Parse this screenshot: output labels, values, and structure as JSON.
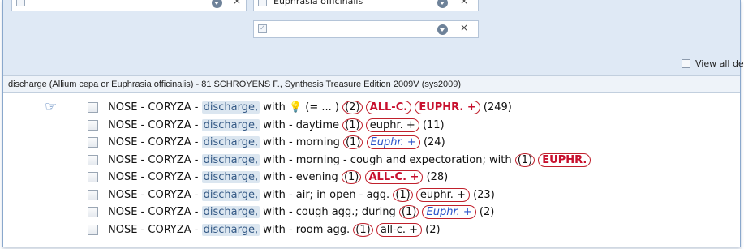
{
  "filters": {
    "combo1_text": "",
    "combo2_text": "Euphrasia officinalis",
    "combo3_text": "",
    "clear_glyph": "×",
    "view_all_label": "View all de"
  },
  "status_bar": {
    "text": "discharge (Allium cepa or Euphrasia officinalis) - 81   SCHROYENS F., Synthesis Treasure Edition 2009V (sys2009)"
  },
  "rubrics": [
    {
      "text": "NOSE - CORYZA - ",
      "keyword": "discharge,",
      "rest": " with ",
      "bulb": true,
      "extra": "  (= ... ) ",
      "count": "(2)",
      "remedies": [
        {
          "name": "ALL-C.",
          "style": "red"
        },
        {
          "name": "EUPHR. +",
          "style": "red"
        }
      ],
      "total": "(249)",
      "pointer": true
    },
    {
      "text": "NOSE - CORYZA - ",
      "keyword": "discharge,",
      "rest": " with - daytime ",
      "count": "(1)",
      "remedies": [
        {
          "name": "euphr. +",
          "style": "plain"
        }
      ],
      "total": "(11)"
    },
    {
      "text": "NOSE - CORYZA - ",
      "keyword": "discharge,",
      "rest": " with - morning ",
      "count": "(1)",
      "remedies": [
        {
          "name": "Euphr. +",
          "style": "blue"
        }
      ],
      "total": "(24)"
    },
    {
      "text": "NOSE - CORYZA - ",
      "keyword": "discharge,",
      "rest": " with - morning - cough and expectoration; with ",
      "count": "(1)",
      "remedies": [
        {
          "name": "EUPHR.",
          "style": "red"
        }
      ],
      "total": ""
    },
    {
      "text": "NOSE - CORYZA - ",
      "keyword": "discharge,",
      "rest": " with - evening ",
      "count": "(1)",
      "remedies": [
        {
          "name": "ALL-C. +",
          "style": "red"
        }
      ],
      "total": "(28)"
    },
    {
      "text": "NOSE - CORYZA - ",
      "keyword": "discharge,",
      "rest": " with - air; in open - agg. ",
      "count": "(1)",
      "remedies": [
        {
          "name": "euphr. +",
          "style": "plain"
        }
      ],
      "total": "(23)"
    },
    {
      "text": "NOSE - CORYZA - ",
      "keyword": "discharge,",
      "rest": " with - cough agg.; during ",
      "count": "(1)",
      "remedies": [
        {
          "name": "Euphr. +",
          "style": "blue"
        }
      ],
      "total": "(2)"
    },
    {
      "text": "NOSE - CORYZA - ",
      "keyword": "discharge,",
      "rest": " with - room agg. ",
      "count": "(1)",
      "remedies": [
        {
          "name": "all-c. +",
          "style": "plain"
        }
      ],
      "total": "(2)"
    }
  ],
  "colors": {
    "highlight_red": "#c8102e",
    "highlight_blue": "#2a52c9",
    "panel_bg": "#dfe9f5"
  }
}
